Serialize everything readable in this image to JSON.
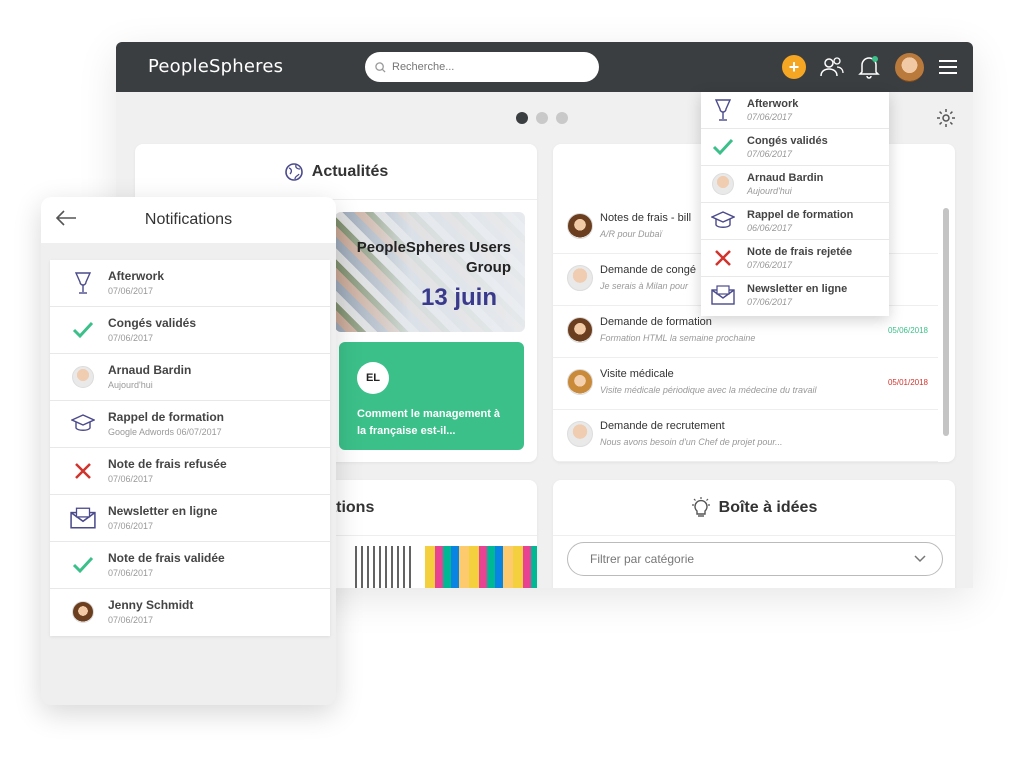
{
  "app": {
    "logo": "PeopleSpheres",
    "search_placeholder": "Recherche...",
    "plus_label": "+"
  },
  "news": {
    "title": "Actualités",
    "image_title": "PeopleSpheres Users Group",
    "image_date": "13 juin",
    "badge": "EL",
    "card_text": "Comment le management à la française est-il..."
  },
  "requests": [
    {
      "title": "Notes de frais - bill",
      "sub": "A/R pour Dubaï",
      "date": "",
      "date_color": "#3cc08a",
      "avatar": "av-woman"
    },
    {
      "title": "Demande de congé",
      "sub": "Je serais à Milan pour",
      "date": "",
      "date_color": "#3cc08a",
      "avatar": "av-man"
    },
    {
      "title": "Demande de formation",
      "sub": "Formation HTML la semaine prochaine",
      "date": "05/06/2018",
      "date_color": "#3cc08a",
      "avatar": "av-woman"
    },
    {
      "title": "Visite médicale",
      "sub": "Visite médicale périodique avec la médecine du travail",
      "date": "05/01/2018",
      "date_color": "#d0342c",
      "avatar": "av-woman2"
    },
    {
      "title": "Demande de recrutement",
      "sub": "Nous avons besoin d'un Chef de projet pour...",
      "date": "",
      "date_color": "#3cc08a",
      "avatar": "av-man"
    }
  ],
  "formations": {
    "title": "ormations"
  },
  "ideas": {
    "title": "Boîte à idées",
    "filter_placeholder": "Filtrer par catégorie"
  },
  "dropdown": [
    {
      "icon": "glass-icon",
      "title": "Afterwork",
      "date": "07/06/2017"
    },
    {
      "icon": "check-icon",
      "title": "Congés validés",
      "date": "07/06/2017"
    },
    {
      "icon": "avatar",
      "title": "Arnaud Bardin",
      "date": "Aujourd'hui"
    },
    {
      "icon": "graduation-cap-icon",
      "title": "Rappel de formation",
      "date": "06/06/2017"
    },
    {
      "icon": "cross-icon",
      "title": "Note de frais rejetée",
      "date": "07/06/2017"
    },
    {
      "icon": "envelope-icon",
      "title": "Newsletter en ligne",
      "date": "07/06/2017"
    }
  ],
  "mobile": {
    "title": "Notifications",
    "items": [
      {
        "icon": "glass-icon",
        "label": "Afterwork",
        "date": "07/06/2017"
      },
      {
        "icon": "check-icon",
        "label": "Congés validés",
        "date": "07/06/2017"
      },
      {
        "icon": "avatar-man",
        "label": "Arnaud Bardin",
        "date": "Aujourd'hui"
      },
      {
        "icon": "graduation-cap-icon",
        "label": "Rappel de formation",
        "date": "Google Adwords 06/07/2017"
      },
      {
        "icon": "cross-icon",
        "label": "Note de frais refusée",
        "date": "07/06/2017"
      },
      {
        "icon": "envelope-icon",
        "label": "Newsletter en ligne",
        "date": "07/06/2017"
      },
      {
        "icon": "check-icon",
        "label": "Note de frais validée",
        "date": "07/06/2017"
      },
      {
        "icon": "avatar-woman",
        "label": "Jenny Schmidt",
        "date": "07/06/2017"
      }
    ]
  },
  "colors": {
    "topbar": "#3b3e41",
    "accent": "#f5a623",
    "green": "#3cc08a",
    "red": "#d0342c",
    "purple": "#4a4a8c"
  }
}
